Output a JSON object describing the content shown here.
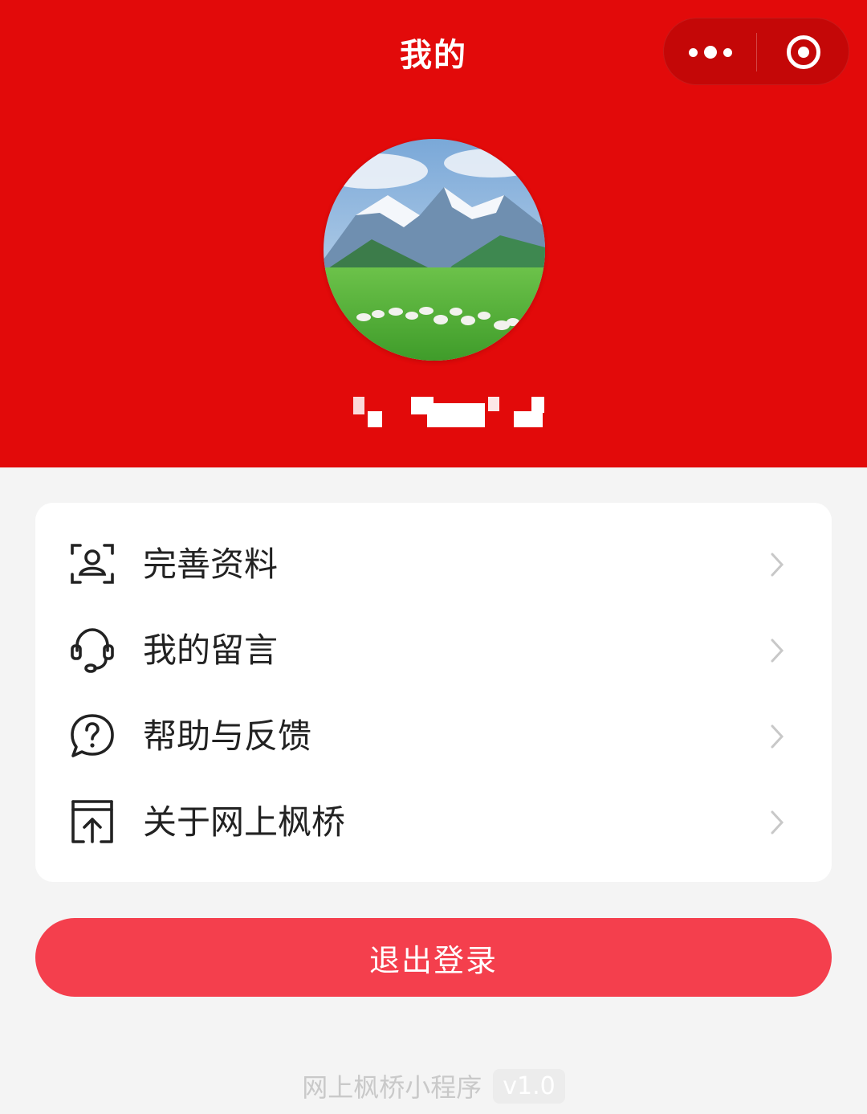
{
  "nav": {
    "title": "我的",
    "more_icon": "more-dots-icon",
    "close_icon": "target-circle-icon"
  },
  "profile": {
    "avatar_icon": "landscape-avatar-image",
    "username": ""
  },
  "menu": {
    "items": [
      {
        "label": "完善资料",
        "icon": "user-scan-icon"
      },
      {
        "label": "我的留言",
        "icon": "headset-icon"
      },
      {
        "label": "帮助与反馈",
        "icon": "help-bubble-icon"
      },
      {
        "label": "关于网上枫桥",
        "icon": "upload-box-icon"
      }
    ]
  },
  "logout": {
    "label": "退出登录"
  },
  "footer": {
    "name": "网上枫桥小程序",
    "version": "v1.0"
  },
  "colors": {
    "header": "#e20a0a",
    "logout": "#f43f4d",
    "background": "#f4f4f4"
  }
}
